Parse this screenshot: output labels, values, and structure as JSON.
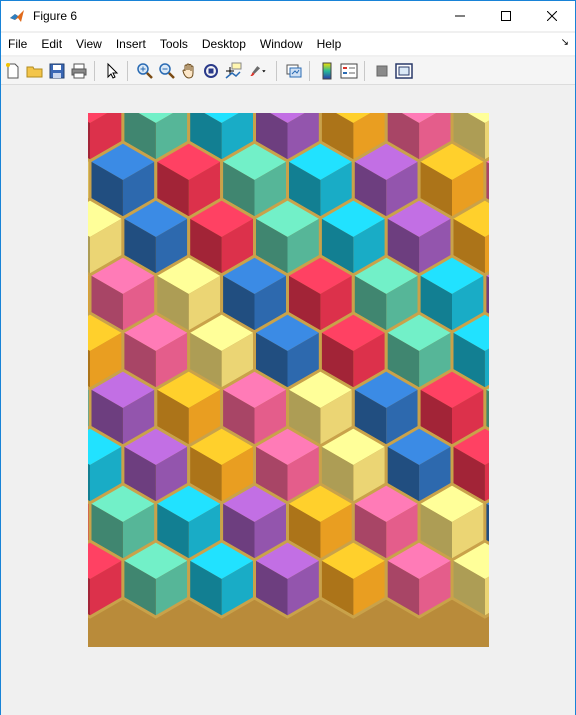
{
  "window": {
    "title": "Figure 6",
    "controls": {
      "minimize": "—",
      "maximize": "☐",
      "close": "✕"
    }
  },
  "menubar": {
    "items": [
      {
        "label": "File"
      },
      {
        "label": "Edit"
      },
      {
        "label": "View"
      },
      {
        "label": "Insert"
      },
      {
        "label": "Tools"
      },
      {
        "label": "Desktop"
      },
      {
        "label": "Window"
      },
      {
        "label": "Help"
      }
    ]
  },
  "toolbar": {
    "icons": [
      "new-figure-icon",
      "open-file-icon",
      "save-figure-icon",
      "print-figure-icon",
      "edit-plot-icon",
      "zoom-in-icon",
      "zoom-out-icon",
      "pan-icon",
      "rotate-3d-icon",
      "data-cursor-icon",
      "brush-icon",
      "link-plot-icon",
      "insert-colorbar-icon",
      "insert-legend-icon",
      "hide-plot-tools-icon",
      "show-plot-tools-icon"
    ]
  },
  "figure": {
    "image_description_colors": [
      "#e8344f",
      "#f06292",
      "#1ab5d0",
      "#2f6fb7",
      "#f5a623",
      "#5bc0a0",
      "#f7e07a",
      "#9b59b6"
    ]
  }
}
